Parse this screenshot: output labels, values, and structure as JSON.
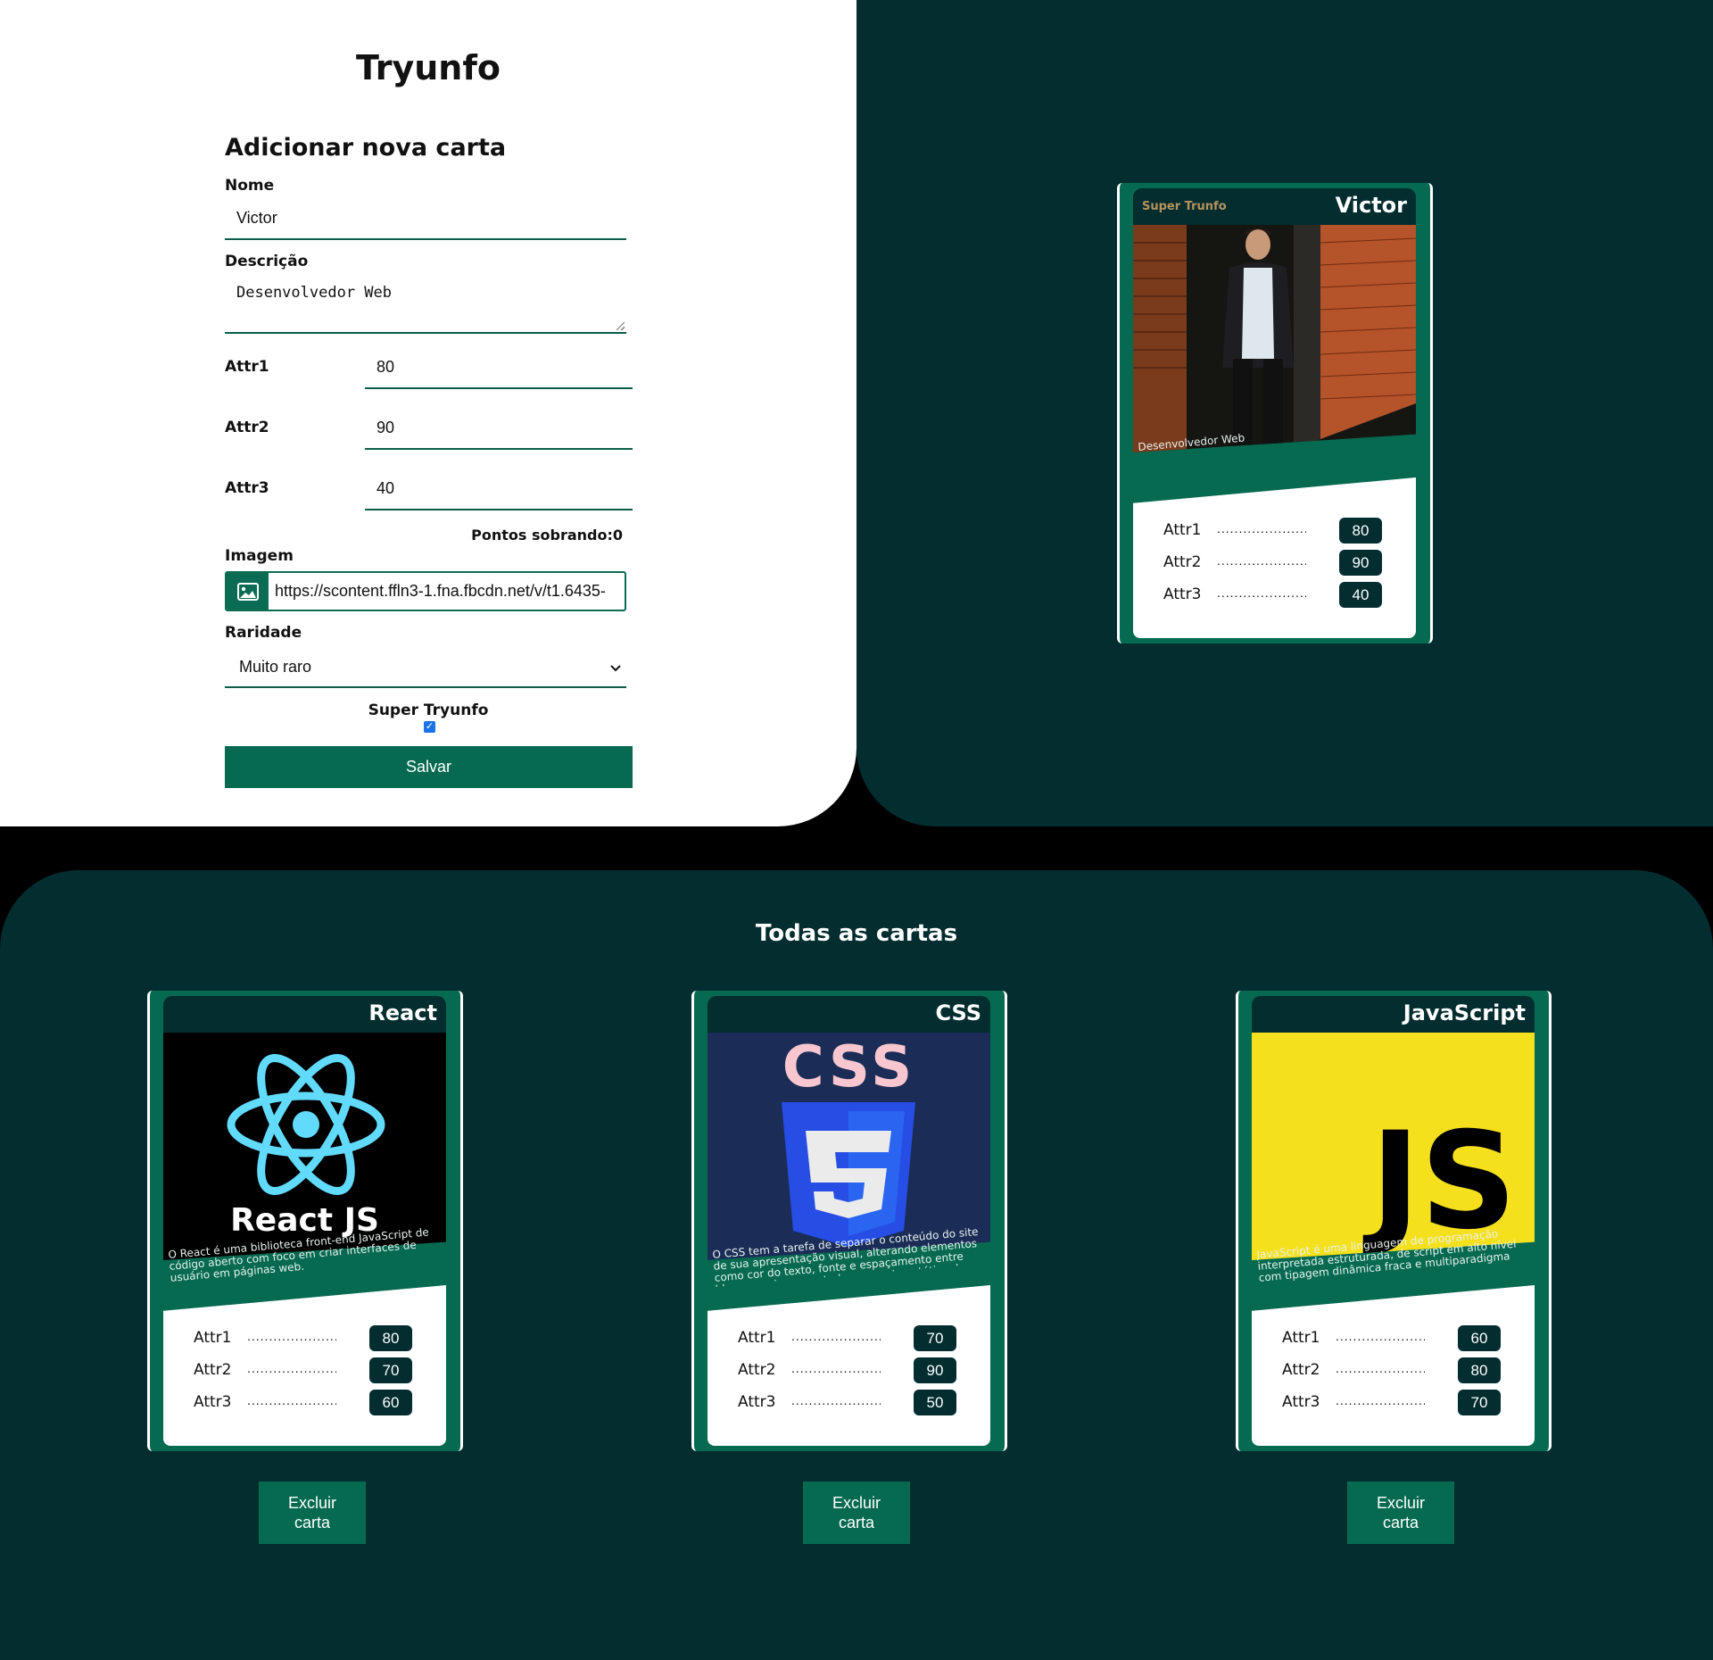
{
  "app": {
    "title": "Tryunfo"
  },
  "form": {
    "title": "Adicionar nova carta",
    "name_label": "Nome",
    "name_value": "Victor",
    "description_label": "Descrição",
    "description_value": "Desenvolvedor Web",
    "attr1_label": "Attr1",
    "attr1_value": "80",
    "attr2_label": "Attr2",
    "attr2_value": "90",
    "attr3_label": "Attr3",
    "attr3_value": "40",
    "points_remaining": "Pontos sobrando:0",
    "image_label": "Imagem",
    "image_value": "https://scontent.ffln3-1.fna.fbcdn.net/v/t1.6435-",
    "rarity_label": "Raridade",
    "rarity_value": "Muito raro",
    "super_label": "Super Tryunfo",
    "super_checked": true,
    "save_label": "Salvar"
  },
  "preview": {
    "name": "Victor",
    "super_badge": "Super Trunfo",
    "description": "Desenvolvedor Web",
    "attrs": [
      {
        "label": "Attr1",
        "value": "80"
      },
      {
        "label": "Attr2",
        "value": "90"
      },
      {
        "label": "Attr3",
        "value": "40"
      }
    ]
  },
  "list": {
    "title": "Todas as cartas",
    "delete_label_line1": "Excluir",
    "delete_label_line2": "carta",
    "cards": [
      {
        "name": "React",
        "image_text": "React JS",
        "description": "O React é uma biblioteca front-end JavaScript de código aberto com foco em criar interfaces de usuário em páginas web.",
        "attrs": [
          {
            "label": "Attr1",
            "value": "80"
          },
          {
            "label": "Attr2",
            "value": "70"
          },
          {
            "label": "Attr3",
            "value": "60"
          }
        ]
      },
      {
        "name": "CSS",
        "image_text": "CSS",
        "description": "O CSS tem a tarefa de separar o conteúdo do site de sua apresentação visual, alterando elementos como cor do texto, fonte e espaçamento entre blocos, assim como todo o aspecto estético de uma página.",
        "attrs": [
          {
            "label": "Attr1",
            "value": "70"
          },
          {
            "label": "Attr2",
            "value": "90"
          },
          {
            "label": "Attr3",
            "value": "50"
          }
        ]
      },
      {
        "name": "JavaScript",
        "image_text": "JS",
        "description": "JavaScript é uma linguagem de programação interpretada estruturada, de script em alto nível com tipagem dinâmica fraca e multiparadigma",
        "attrs": [
          {
            "label": "Attr1",
            "value": "60"
          },
          {
            "label": "Attr2",
            "value": "80"
          },
          {
            "label": "Attr3",
            "value": "70"
          }
        ]
      }
    ]
  },
  "colors": {
    "dark": "#032d2f",
    "green": "#066a51",
    "gold": "#b7935a",
    "css_pink": "#f7c6cf",
    "css_blue": "#264de4",
    "react_cyan": "#61dafb",
    "js_yellow": "#f7df1e"
  }
}
